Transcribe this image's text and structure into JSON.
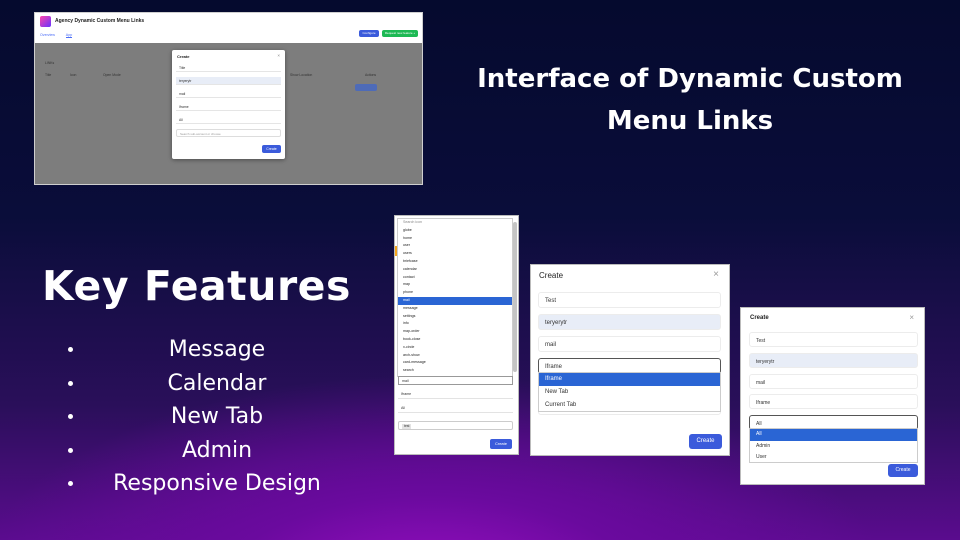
{
  "headline": {
    "line1": "Interface of  Dynamic Custom",
    "line2": "Menu Links"
  },
  "key_features": {
    "title": "Key Features",
    "items": [
      "Message",
      "Calendar",
      "New Tab",
      "Admin",
      "Responsive Design"
    ]
  },
  "screenshot_main": {
    "app_title": "Agency Dynamic Custom Menu Links",
    "tabs": [
      "Overview",
      "App"
    ],
    "buttons": [
      "Configure",
      "Request new feature +"
    ],
    "table_label": "LINKs",
    "columns": [
      "Title",
      "Icon",
      "Open Mode",
      "Show Location",
      "Actions"
    ],
    "modal": {
      "title": "Create",
      "close": "×",
      "fields": [
        "Title",
        "teryerytr",
        "mail",
        "Iframe",
        "All"
      ],
      "select_placeholder": "Search sub-account or choose",
      "create_label": "Create"
    }
  },
  "screenshot_list": {
    "items": [
      "Search icon",
      "globe",
      "home",
      "user",
      "users",
      "briefcase",
      "calendar",
      "contact",
      "map",
      "phone",
      "mail",
      "message",
      "settings",
      "info",
      "map-order",
      "book-close",
      "x-circle",
      "arch-show",
      "card-message",
      "search"
    ],
    "selected": "mail",
    "field_value": "mail",
    "field_iframe": "Iframe",
    "field_all": "All",
    "tag": "test",
    "create_label": "Create"
  },
  "screenshot_open_mode": {
    "title": "Create",
    "close": "×",
    "fields": [
      "Test",
      "teryerytr",
      "mail",
      "Iframe"
    ],
    "options": [
      "Iframe",
      "New Tab",
      "Current Tab"
    ],
    "selected": "Iframe",
    "create_label": "Create"
  },
  "screenshot_visibility": {
    "title": "Create",
    "close": "×",
    "fields": [
      "Test",
      "teryerytr",
      "mail",
      "Iframe",
      "All"
    ],
    "options": [
      "All",
      "Admin",
      "User"
    ],
    "selected": "All",
    "create_label": "Create"
  }
}
